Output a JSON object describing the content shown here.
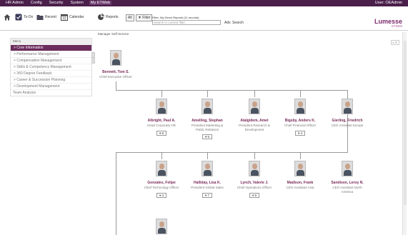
{
  "topbar": {
    "menu": [
      "HR Admin",
      "Config",
      "Security",
      "System",
      "My ETWeb"
    ],
    "user": "User: OEAdmin"
  },
  "toolbar": {
    "home_icon": "home-icon",
    "todo": "To-Do",
    "recent": "Recent",
    "calendar": "Calendar",
    "reports": "Reports",
    "all_label": "All",
    "filter_label": "Filter",
    "filter_header": "Filter: My Direct Reports (11 records)",
    "search_placeholder": "Search in current filter",
    "adv_search": "Adv. Search"
  },
  "logo": {
    "name": "Lumesse",
    "sub": "ETWeb"
  },
  "breadcrumb": "Manager Self-Service",
  "sidebar": {
    "header": "Menu",
    "items": [
      "> Core Information",
      "> Performance Management",
      "> Compensation Management",
      "> Skills & Competency Management",
      "> 360 Degree Feedback",
      "> Career & Succession Planning",
      "> Development Management"
    ],
    "extra": "Team Analysis"
  },
  "expand_label": "▸ ⊡",
  "ceo": {
    "name": "Bennett, Tom S.",
    "title": "Chief Executive Officer"
  },
  "row1": [
    {
      "name": "Albright, Paul A.",
      "title": "Head Corporate HR",
      "count": "▾ 8"
    },
    {
      "name": "Amelling, Stephan",
      "title": "President Marketing & Public Relations",
      "count": "▾ 5"
    },
    {
      "name": "Atalgidem, Amet",
      "title": "President Research & Development",
      "count": ""
    },
    {
      "name": "Bigsby, Anders K.",
      "title": "Chief Financial Officer",
      "count": "▾ 4"
    },
    {
      "name": "Gierling, Friedrich",
      "title": "CEO Assistant Europe",
      "count": ""
    }
  ],
  "row2": [
    {
      "name": "Gonzales, Felipe",
      "title": "Chief Technology Officer",
      "count": "▾ 4"
    },
    {
      "name": "Halliday, Lisa K.",
      "title": "President Global Sales",
      "count": "▾ 7"
    },
    {
      "name": "Lynch, Valerie J.",
      "title": "Chief Operations Officer",
      "count": "▾ 9"
    },
    {
      "name": "Madison, Frank",
      "title": "CEO Assistant Asia",
      "count": ""
    },
    {
      "name": "Sandison, Leroy N.",
      "title": "CEO Assistant North America",
      "count": ""
    }
  ]
}
